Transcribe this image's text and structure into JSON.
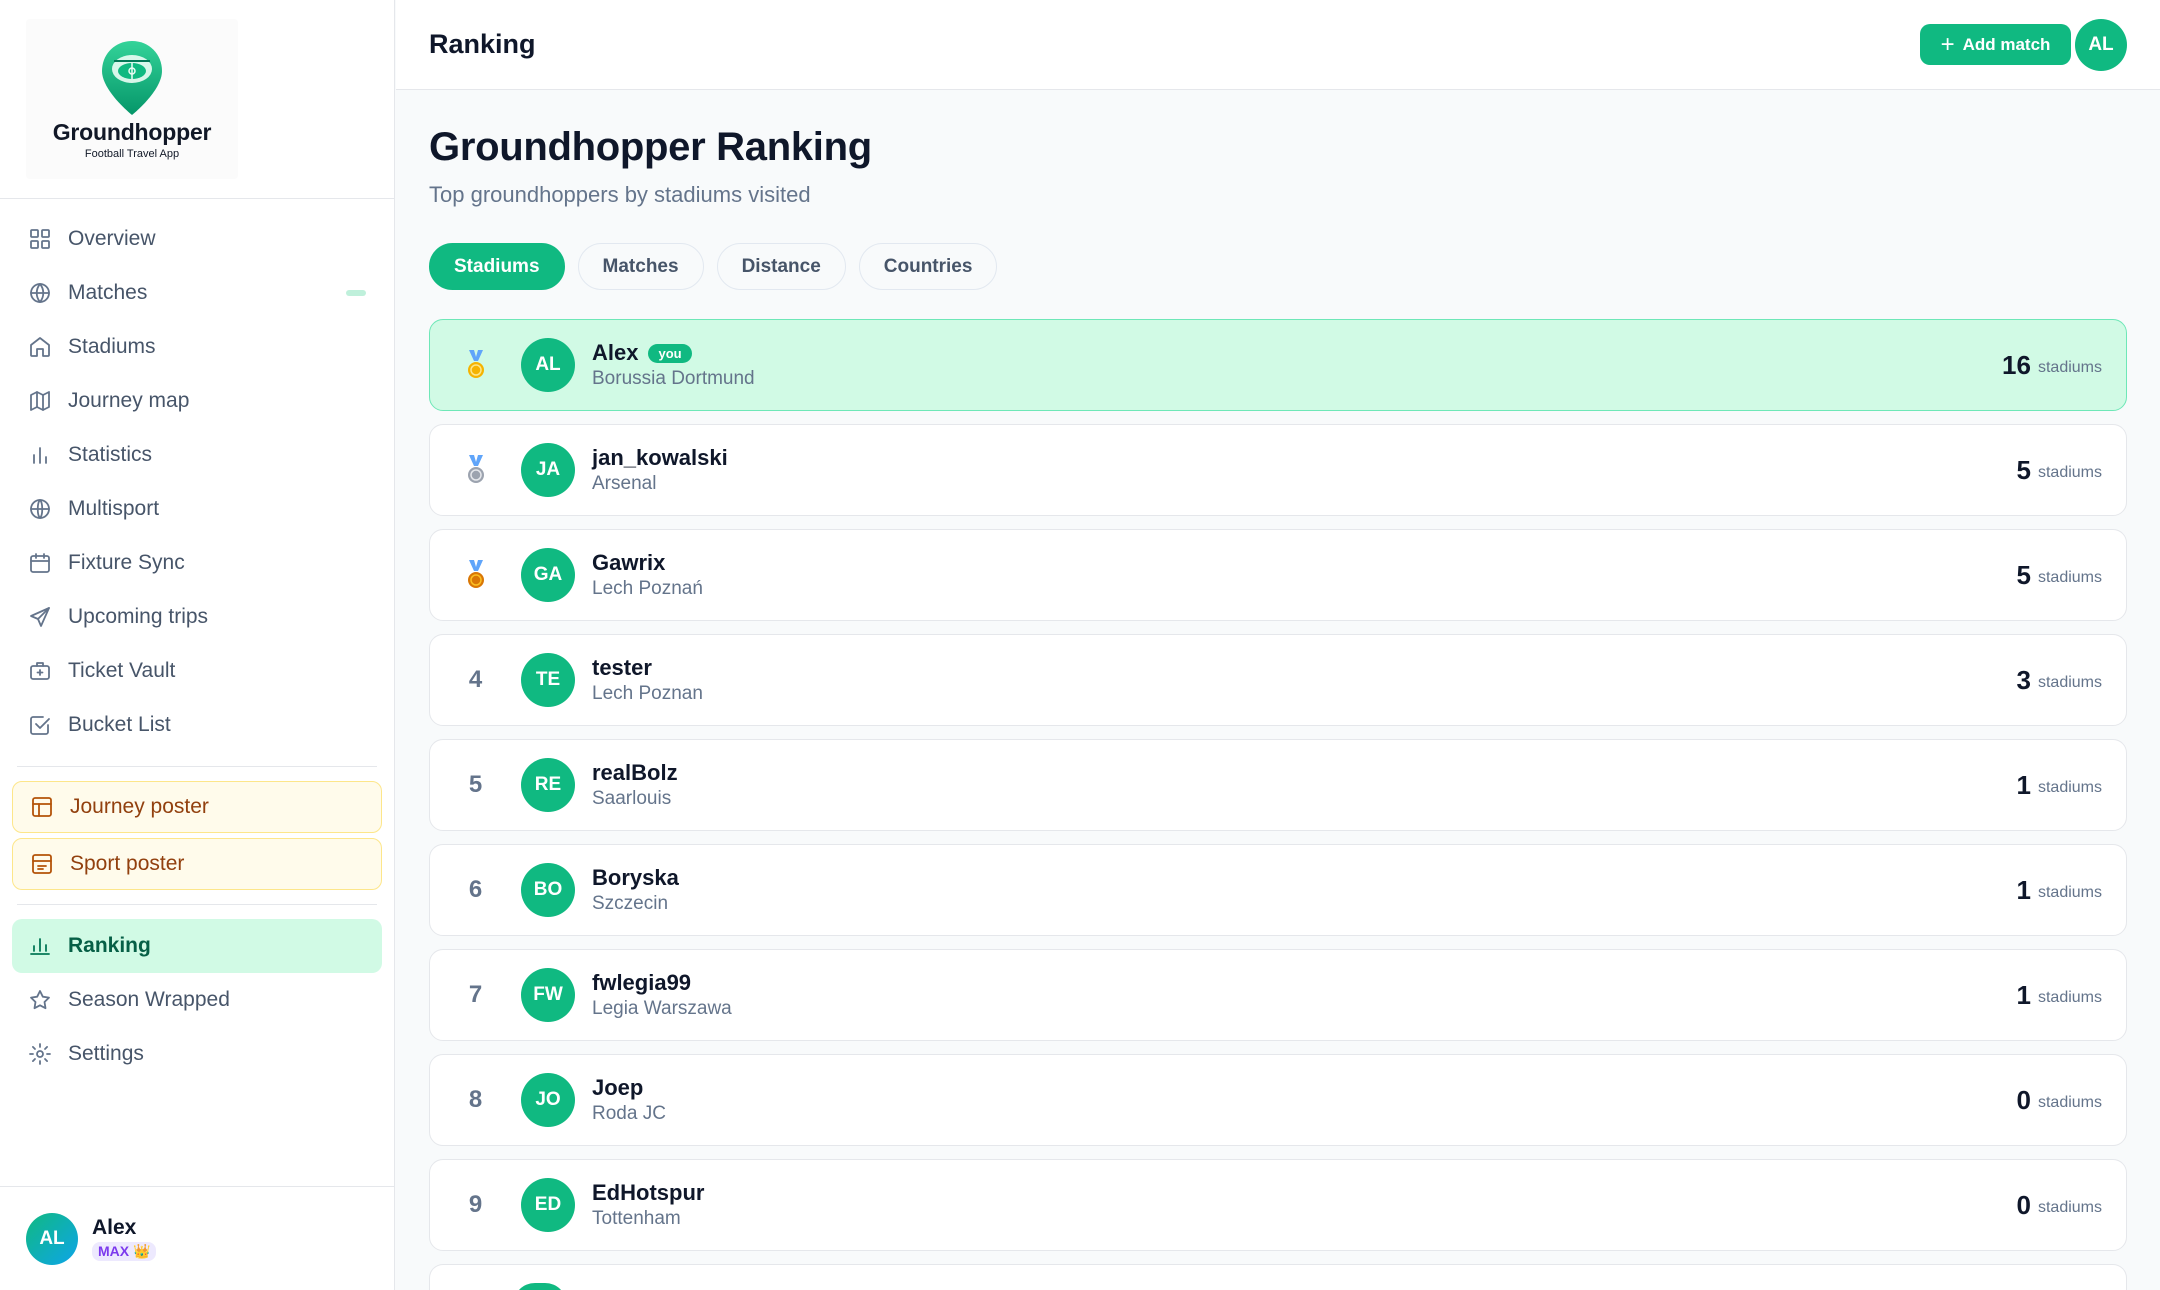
{
  "brand": {
    "title": "Groundhopper",
    "subtitle": "Football Travel App"
  },
  "sidebar": {
    "items": [
      {
        "label": "Overview",
        "icon": "grid-icon"
      },
      {
        "label": "Matches",
        "icon": "ball-icon"
      },
      {
        "label": "Stadiums",
        "icon": "home-icon"
      },
      {
        "label": "Journey map",
        "icon": "map-icon"
      },
      {
        "label": "Statistics",
        "icon": "bar-chart-icon"
      },
      {
        "label": "Multisport",
        "icon": "globe-icon"
      },
      {
        "label": "Fixture Sync",
        "icon": "calendar-icon"
      },
      {
        "label": "Upcoming trips",
        "icon": "send-icon"
      },
      {
        "label": "Ticket Vault",
        "icon": "briefcase-icon"
      },
      {
        "label": "Bucket List",
        "icon": "checkbox-icon"
      }
    ],
    "posters": [
      {
        "label": "Journey poster",
        "icon": "layout-icon"
      },
      {
        "label": "Sport poster",
        "icon": "image-icon"
      }
    ],
    "bottom": [
      {
        "label": "Ranking",
        "icon": "bar-chart-icon",
        "active": true
      },
      {
        "label": "Season Wrapped",
        "icon": "star-icon"
      },
      {
        "label": "Settings",
        "icon": "gear-icon"
      }
    ],
    "user": {
      "initials": "AL",
      "name": "Alex",
      "badge": "MAX 👑"
    }
  },
  "topbar": {
    "title": "Ranking",
    "add_label": "Add match",
    "avatar": "AL"
  },
  "page": {
    "title": "Groundhopper Ranking",
    "subtitle": "Top groundhoppers by stadiums visited",
    "tabs": [
      "Stadiums",
      "Matches",
      "Distance",
      "Countries"
    ],
    "active_tab": "Stadiums"
  },
  "ranking": {
    "unit": "stadiums",
    "you_label": "you",
    "medal_colors": {
      "gold": "#f5b301",
      "silver": "#9ca3af",
      "bronze": "#d97706"
    },
    "rows": [
      {
        "rank": "1",
        "medal": "gold",
        "initials": "AL",
        "name": "Alex",
        "club": "Borussia Dortmund",
        "count": "16",
        "me": true
      },
      {
        "rank": "2",
        "medal": "silver",
        "initials": "JA",
        "name": "jan_kowalski",
        "club": "Arsenal",
        "count": "5"
      },
      {
        "rank": "3",
        "medal": "bronze",
        "initials": "GA",
        "name": "Gawrix",
        "club": "Lech Poznań",
        "count": "5"
      },
      {
        "rank": "4",
        "initials": "TE",
        "name": "tester",
        "club": "Lech Poznan",
        "count": "3"
      },
      {
        "rank": "5",
        "initials": "RE",
        "name": "realBolz",
        "club": "Saarlouis",
        "count": "1"
      },
      {
        "rank": "6",
        "initials": "BO",
        "name": "Boryska",
        "club": "Szczecin",
        "count": "1"
      },
      {
        "rank": "7",
        "initials": "FW",
        "name": "fwlegia99",
        "club": "Legia Warszawa",
        "count": "1"
      },
      {
        "rank": "8",
        "initials": "JO",
        "name": "Joep",
        "club": "Roda JC",
        "count": "0"
      },
      {
        "rank": "9",
        "initials": "ED",
        "name": "EdHotspur",
        "club": "Tottenham",
        "count": "0"
      }
    ]
  },
  "colors": {
    "accent": "#10b981",
    "accent_light": "#d1fae5",
    "poster_bg": "#fffbeb"
  }
}
